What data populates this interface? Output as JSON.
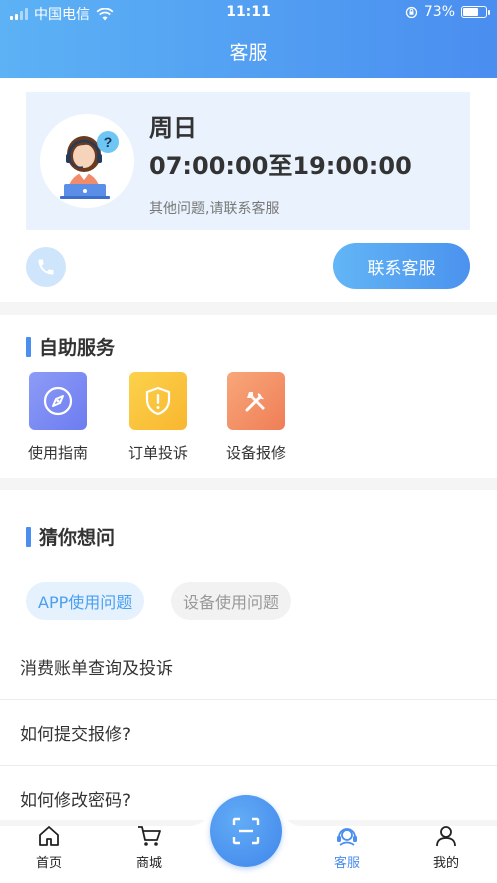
{
  "status_bar": {
    "carrier": "中国电信",
    "time": "11:11",
    "battery": "73%",
    "battery_level": 0.73
  },
  "header": {
    "title": "客服"
  },
  "service_hours": {
    "day": "周日",
    "hours": "07:00:00至19:00:00",
    "note": "其他问题,请联系客服"
  },
  "actions": {
    "contact_label": "联系客服",
    "phone_icon": "phone-icon"
  },
  "self_service": {
    "title": "自助服务",
    "items": [
      {
        "label": "使用指南",
        "icon": "compass-icon",
        "color_from": "#8d9cf6",
        "color_to": "#6d7cf0"
      },
      {
        "label": "订单投诉",
        "icon": "shield-alert-icon",
        "color_from": "#fcd24c",
        "color_to": "#f9b62f"
      },
      {
        "label": "设备报修",
        "icon": "tools-icon",
        "color_from": "#f8a77a",
        "color_to": "#ef7e57"
      }
    ]
  },
  "faq": {
    "title": "猜你想问",
    "tabs": [
      {
        "label": "APP使用问题",
        "active": true
      },
      {
        "label": "设备使用问题",
        "active": false
      }
    ],
    "questions": [
      "消费账单查询及投诉",
      "如何提交报修?",
      "如何修改密码?"
    ]
  },
  "bottom_nav": {
    "items": [
      {
        "label": "首页",
        "icon": "home-icon",
        "active": false
      },
      {
        "label": "商城",
        "icon": "cart-icon",
        "active": false
      },
      {
        "label": "客服",
        "icon": "headset-icon",
        "active": true
      },
      {
        "label": "我的",
        "icon": "user-icon",
        "active": false
      }
    ],
    "scan_icon": "scan-icon"
  },
  "colors": {
    "primary": "#4a8ef0",
    "primary_light": "#5cb2f5"
  }
}
